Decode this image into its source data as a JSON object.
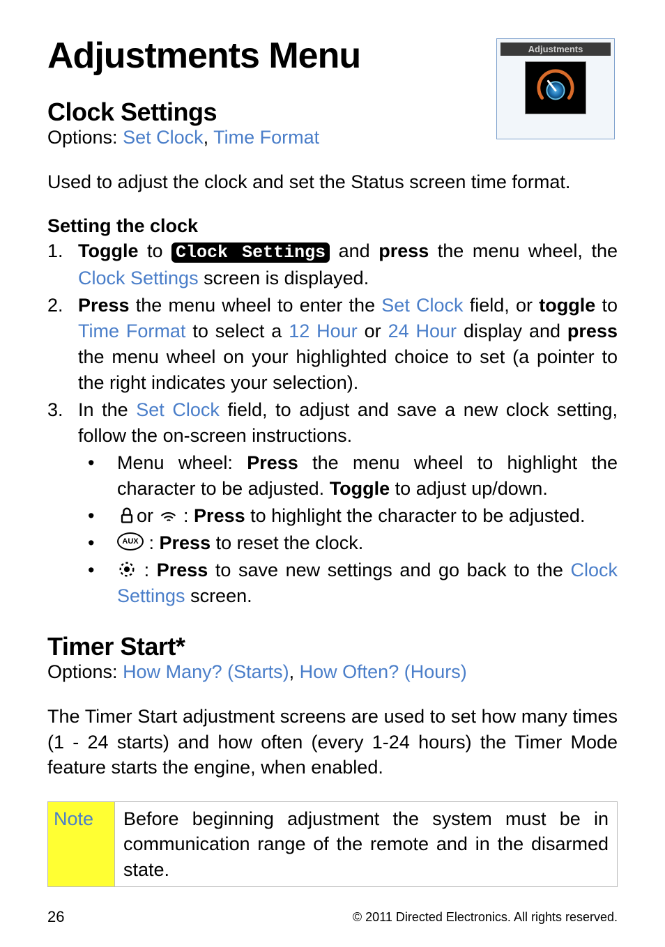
{
  "pageTitle": "Adjustments Menu",
  "thumbnail": {
    "title": "Adjustments"
  },
  "section1": {
    "heading": "Clock Settings",
    "optionsPrefix": "Options: ",
    "option1": "Set Clock",
    "optionsSep": ", ",
    "option2": "Time Format",
    "descPara": "Used to adjust the clock and set the Status screen time format.",
    "subHeading": "Setting the clock",
    "li1": {
      "num": "1.",
      "t1": "Toggle",
      "t2": " to ",
      "chip": "Clock Settings",
      "t3": " and ",
      "t4": "press",
      "t5": " the menu wheel, the ",
      "t6": "Clock Settings",
      "t7": " screen is displayed."
    },
    "li2": {
      "num": "2.",
      "t1": "Press",
      "t2": " the menu wheel to enter the ",
      "t3": "Set Clock",
      "t4": " field, or ",
      "t5": "toggle",
      "t6": " to ",
      "t7": "Time Format",
      "t8": " to select a ",
      "t9": "12 Hour",
      "t10": " or ",
      "t11": "24 Hour",
      "t12": " display and ",
      "t13": "press",
      "t14": " the menu wheel on your highlighted choice to set (a pointer to the right indicates your selection)."
    },
    "li3": {
      "num": "3.",
      "t1": "In the ",
      "t2": "Set Clock",
      "t3": " field, to adjust and save a new clock setting, follow the on-screen instructions."
    },
    "b1": {
      "t1": "Menu wheel: ",
      "t2": "Press",
      "t3": " the menu wheel to highlight the character to be adjusted. ",
      "t4": "Toggle",
      "t5": " to adjust up/down."
    },
    "b2": {
      "t1": "or",
      "t2": " : ",
      "t3": "Press",
      "t4": " to highlight the character to be adjusted."
    },
    "b3": {
      "aux": "AUX",
      "t1": " : ",
      "t2": "Press",
      "t3": " to reset the clock."
    },
    "b4": {
      "t1": " : ",
      "t2": "Press",
      "t3": " to save new settings and go back to the ",
      "t4": "Clock Settings",
      "t5": " screen."
    }
  },
  "section2": {
    "heading": "Timer Start*",
    "optionsPrefix": "Options: ",
    "option1": "How Many? (Starts)",
    "optionsSep": ", ",
    "option2": "How Often? (Hours)",
    "descPara": "The Timer Start adjustment screens are used to set how many times (1 - 24 starts) and how often (every 1-24 hours) the Timer Mode feature starts the engine, when enabled."
  },
  "note": {
    "label": "Note",
    "text": "Before beginning adjustment the system must be in communication range of the remote and in the disarmed state."
  },
  "footer": {
    "page": "26",
    "copyright": "© 2011 Directed Electronics. All rights reserved."
  }
}
